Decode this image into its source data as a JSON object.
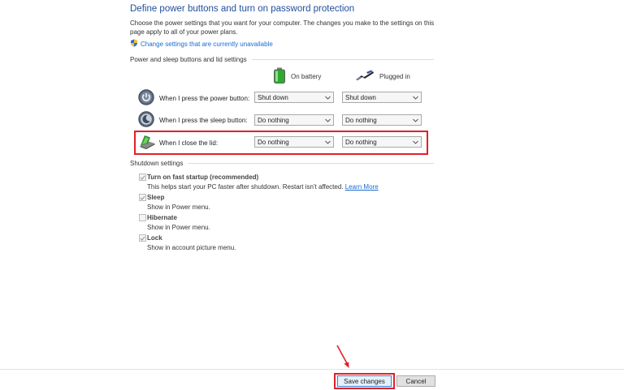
{
  "header": {
    "title": "Define power buttons and turn on password protection",
    "description": "Choose the power settings that you want for your computer. The changes you make to the settings on this page apply to all of your power plans.",
    "change_link": "Change settings that are currently unavailable"
  },
  "power_section": {
    "heading": "Power and sleep buttons and lid settings",
    "columns": {
      "battery": "On battery",
      "plugged": "Plugged in"
    },
    "rows": [
      {
        "label": "When I press the power button:",
        "battery": "Shut down",
        "plugged": "Shut down",
        "icon": "power-button-icon"
      },
      {
        "label": "When I press the sleep button:",
        "battery": "Do nothing",
        "plugged": "Do nothing",
        "icon": "sleep-button-icon"
      },
      {
        "label": "When I close the lid:",
        "battery": "Do nothing",
        "plugged": "Do nothing",
        "icon": "laptop-lid-icon",
        "highlighted": true
      }
    ]
  },
  "shutdown_section": {
    "heading": "Shutdown settings",
    "items": [
      {
        "label": "Turn on fast startup (recommended)",
        "checked": true,
        "desc": "This helps start your PC faster after shutdown. Restart isn't affected.",
        "link": "Learn More"
      },
      {
        "label": "Sleep",
        "checked": true,
        "desc": "Show in Power menu."
      },
      {
        "label": "Hibernate",
        "checked": false,
        "desc": "Show in Power menu."
      },
      {
        "label": "Lock",
        "checked": true,
        "desc": "Show in account picture menu."
      }
    ]
  },
  "footer": {
    "save_label": "Save changes",
    "cancel_label": "Cancel"
  },
  "colors": {
    "title": "#1f4e9c",
    "link": "#1a6bd0",
    "highlight": "#e0202a"
  }
}
